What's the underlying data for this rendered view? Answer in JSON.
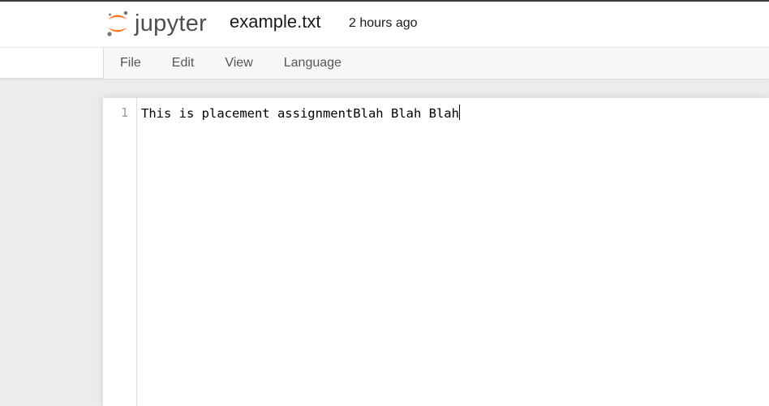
{
  "header": {
    "logo_text": "jupyter",
    "filename": "example.txt",
    "last_modified": "2 hours ago"
  },
  "menu": {
    "items": [
      {
        "label": "File"
      },
      {
        "label": "Edit"
      },
      {
        "label": "View"
      },
      {
        "label": "Language"
      }
    ]
  },
  "editor": {
    "lines": [
      {
        "number": "1",
        "text": "This is placement assignmentBlah Blah Blah"
      }
    ]
  },
  "colors": {
    "brand_orange": "#f37726",
    "brand_gray": "#767677"
  },
  "icons": {
    "logo": "jupyter-logo-icon"
  }
}
